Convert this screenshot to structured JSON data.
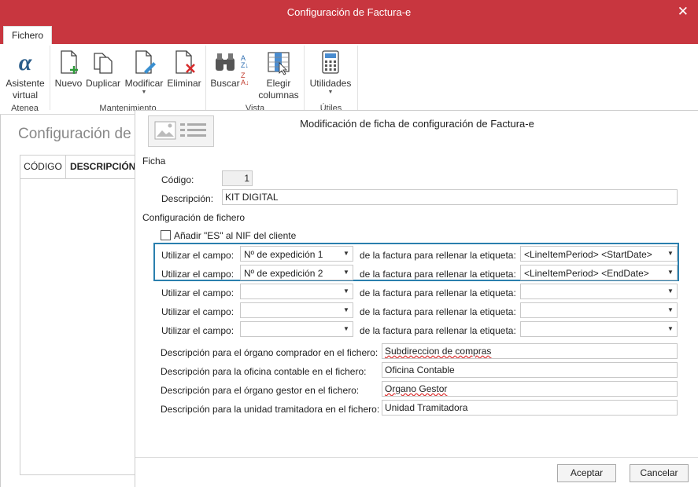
{
  "window": {
    "title": "Configuración de Factura-e"
  },
  "ribbon": {
    "tab_file": "Fichero",
    "groups": {
      "atenea": "Atenea",
      "mantenimiento": "Mantenimiento",
      "vista": "Vista",
      "utiles": "Útiles"
    },
    "buttons": {
      "asistente_1": "Asistente",
      "asistente_2": "virtual",
      "nuevo": "Nuevo",
      "duplicar": "Duplicar",
      "modificar": "Modificar",
      "eliminar": "Eliminar",
      "buscar": "Buscar",
      "elegir_1": "Elegir",
      "elegir_2": "columnas",
      "utilidades": "Utilidades"
    }
  },
  "left_panel": {
    "heading": "Configuración de Factura-e",
    "columns": [
      "CÓDIGO",
      "DESCRIPCIÓN"
    ]
  },
  "dialog": {
    "title": "Modificación de ficha de configuración de Factura-e",
    "ficha_section": "Ficha",
    "codigo_label": "Código:",
    "codigo_value": "1",
    "descripcion_label": "Descripción:",
    "descripcion_value": "KIT DIGITAL",
    "config_section": "Configuración de fichero",
    "anadir_es_label": "Añadir \"ES\" al NIF del cliente",
    "anadir_es_checked": false,
    "field_rows": [
      {
        "prefix": "Utilizar el campo:",
        "field": "Nº de expedición 1",
        "middle": "de la factura para rellenar la etiqueta:",
        "tag": "<LineItemPeriod> <StartDate>"
      },
      {
        "prefix": "Utilizar el campo:",
        "field": "Nº de expedición 2",
        "middle": "de la factura para rellenar la etiqueta:",
        "tag": "<LineItemPeriod> <EndDate>"
      },
      {
        "prefix": "Utilizar el campo:",
        "field": "",
        "middle": "de la factura para rellenar la etiqueta:",
        "tag": ""
      },
      {
        "prefix": "Utilizar el campo:",
        "field": "",
        "middle": "de la factura para rellenar la etiqueta:",
        "tag": ""
      },
      {
        "prefix": "Utilizar el campo:",
        "field": "",
        "middle": "de la factura para rellenar la etiqueta:",
        "tag": ""
      }
    ],
    "desc_rows": [
      {
        "label": "Descripción para el órgano comprador en el fichero:",
        "value": "Subdireccion de compras"
      },
      {
        "label": "Descripción para la oficina contable en el fichero:",
        "value": "Oficina Contable"
      },
      {
        "label": "Descripción para el órgano gestor en el fichero:",
        "value": "Organo Gestor"
      },
      {
        "label": "Descripción para la unidad tramitadora en el fichero:",
        "value": "Unidad Tramitadora"
      }
    ],
    "accept_button": "Aceptar",
    "cancel_button": "Cancelar"
  },
  "colors": {
    "brand": "#c8363f",
    "highlight": "#2a7fae"
  }
}
